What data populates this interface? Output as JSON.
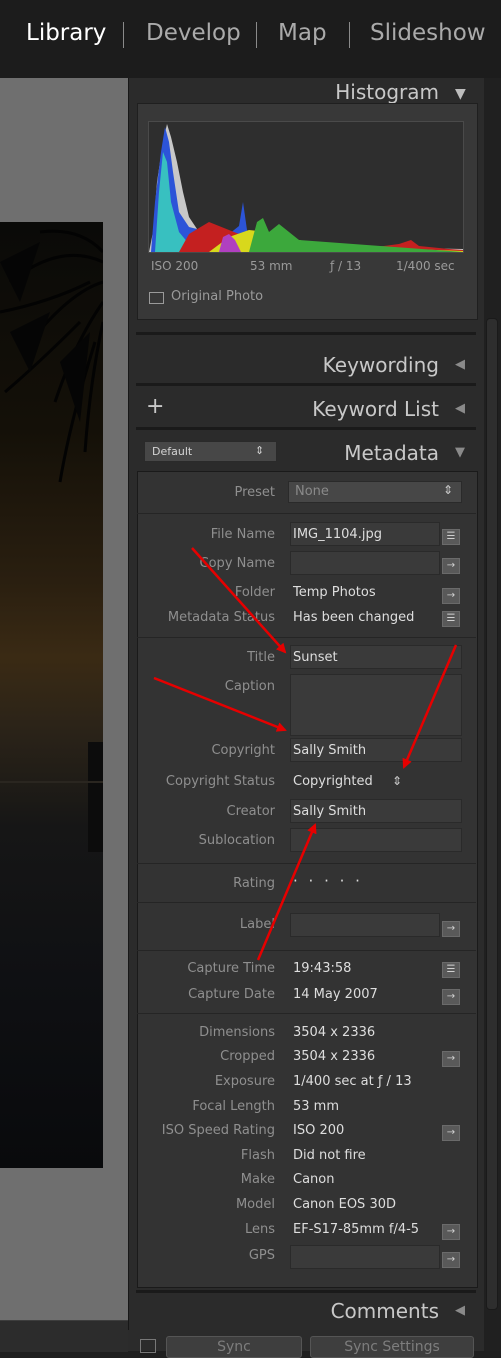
{
  "modules": [
    "Library",
    "Develop",
    "Map",
    "Slideshow"
  ],
  "histogram": {
    "title": "Histogram",
    "iso": "ISO 200",
    "focal": "53 mm",
    "aperture": "ƒ / 13",
    "shutter": "1/400 sec",
    "original_photo": "Original Photo"
  },
  "panels": {
    "keywording": "Keywording",
    "keyword_list": "Keyword List",
    "keyword_add": "+",
    "metadata": "Metadata",
    "metadata_preset_select": "Default",
    "comments": "Comments"
  },
  "metadata": {
    "preset": {
      "label": "Preset",
      "value": "None"
    },
    "file_name": {
      "label": "File Name",
      "value": "IMG_1104.jpg"
    },
    "copy_name": {
      "label": "Copy Name",
      "value": ""
    },
    "folder": {
      "label": "Folder",
      "value": "Temp Photos"
    },
    "metadata_status": {
      "label": "Metadata Status",
      "value": "Has been changed"
    },
    "title": {
      "label": "Title",
      "value": "Sunset"
    },
    "caption": {
      "label": "Caption",
      "value": ""
    },
    "copyright": {
      "label": "Copyright",
      "value": "Sally Smith"
    },
    "copyright_status": {
      "label": "Copyright Status",
      "value": "Copyrighted"
    },
    "creator": {
      "label": "Creator",
      "value": "Sally Smith"
    },
    "sublocation": {
      "label": "Sublocation",
      "value": ""
    },
    "rating": {
      "label": "Rating",
      "value": "· · · · ·"
    },
    "label": {
      "label": "Label",
      "value": ""
    },
    "capture_time": {
      "label": "Capture Time",
      "value": "19:43:58"
    },
    "capture_date": {
      "label": "Capture Date",
      "value": "14 May 2007"
    },
    "dimensions": {
      "label": "Dimensions",
      "value": "3504 x 2336"
    },
    "cropped": {
      "label": "Cropped",
      "value": "3504 x 2336"
    },
    "exposure": {
      "label": "Exposure",
      "value": "1/400 sec at ƒ / 13"
    },
    "focal_length": {
      "label": "Focal Length",
      "value": "53 mm"
    },
    "iso": {
      "label": "ISO Speed Rating",
      "value": "ISO 200"
    },
    "flash": {
      "label": "Flash",
      "value": "Did not fire"
    },
    "make": {
      "label": "Make",
      "value": "Canon"
    },
    "model": {
      "label": "Model",
      "value": "Canon EOS 30D"
    },
    "lens": {
      "label": "Lens",
      "value": "EF-S17-85mm f/4-5"
    },
    "gps": {
      "label": "GPS",
      "value": ""
    }
  },
  "bottom": {
    "sync": "Sync",
    "sync_settings": "Sync Settings"
  },
  "colors": {
    "arrow": "#e60000",
    "panel_bg": "#2b2b2b",
    "active_module": "#ffffff"
  }
}
